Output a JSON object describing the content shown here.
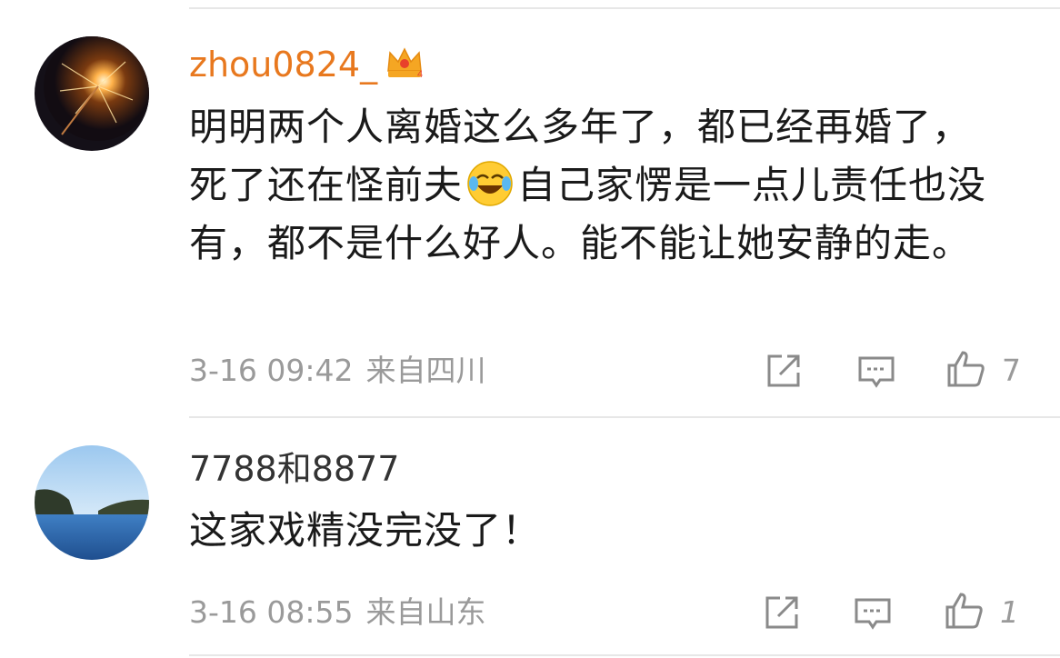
{
  "comments": [
    {
      "username": "zhou0824_",
      "text_part1": "明明两个人离婚这么多年了，都已经再婚了，死了还在怪前夫",
      "text_part2": "自己家愣是一点儿责任也没有，都不是什么好人。能不能让她安静的走。",
      "emoji": "laugh-cry-emoji",
      "date": "3-16 09:42",
      "location": "来自四川",
      "like_count": "7"
    },
    {
      "username": "7788和8877",
      "text": "这家戏精没完没了！",
      "date": "3-16 08:55",
      "location": "来自山东",
      "like_count": "1"
    }
  ],
  "colors": {
    "vip_name": "#e8781e",
    "normal_name": "#333333",
    "text": "#1a1a1a",
    "meta": "#9a9a9a",
    "divider": "#e7e7e7"
  },
  "icons": [
    "crown-icon",
    "share-icon",
    "reply-icon",
    "like-icon"
  ]
}
